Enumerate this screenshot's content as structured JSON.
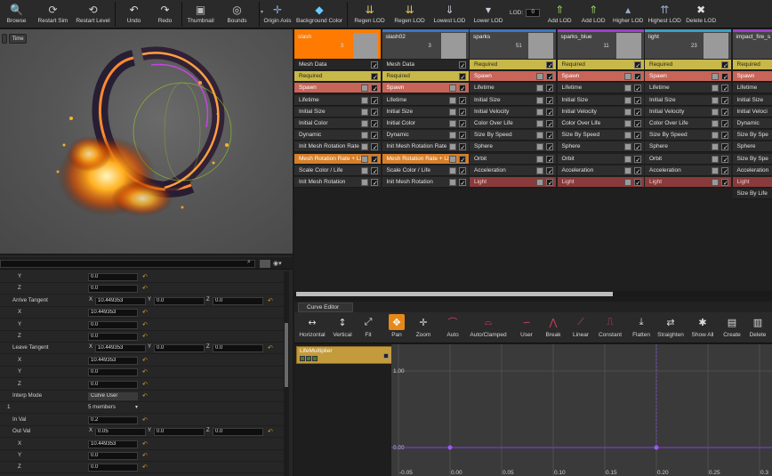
{
  "toolbar": {
    "buttons": [
      {
        "label": "Browse",
        "icon": "browse-icon"
      },
      {
        "label": "Restart Sim",
        "icon": "restart-sim-icon"
      },
      {
        "label": "Restart Level",
        "icon": "restart-level-icon"
      },
      {
        "label": "Undo",
        "icon": "undo-icon"
      },
      {
        "label": "Redo",
        "icon": "redo-icon"
      },
      {
        "label": "Thumbnail",
        "icon": "thumbnail-icon"
      },
      {
        "label": "Bounds",
        "icon": "bounds-icon"
      },
      {
        "label": "Origin Axis",
        "icon": "origin-axis-icon"
      },
      {
        "label": "Background Color",
        "icon": "background-color-icon"
      },
      {
        "label": "Regen LOD",
        "icon": "regen-lod-icon"
      },
      {
        "label": "Regen LOD",
        "icon": "regen-lod-icon"
      },
      {
        "label": "Lowest LOD",
        "icon": "lowest-lod-icon"
      },
      {
        "label": "Lower LOD",
        "icon": "lower-lod-icon"
      },
      {
        "label": "Add LOD",
        "icon": "add-lod-icon"
      },
      {
        "label": "Add LOD",
        "icon": "add-lod-icon"
      },
      {
        "label": "Higher LOD",
        "icon": "higher-lod-icon"
      },
      {
        "label": "Highest LOD",
        "icon": "highest-lod-icon"
      },
      {
        "label": "Delete LOD",
        "icon": "delete-lod-icon"
      }
    ],
    "lod_label": "LOD:",
    "lod_value": "0"
  },
  "viewport": {
    "time_button": "Time"
  },
  "details": {
    "rows": [
      {
        "label": "Y",
        "indent": 20,
        "fields": [
          "0.0"
        ]
      },
      {
        "label": "Z",
        "indent": 20,
        "fields": [
          "0.0"
        ]
      },
      {
        "label": "Arrive Tangent",
        "indent": 14,
        "xyz": [
          "10.449353",
          "0.0",
          "0.0"
        ]
      },
      {
        "label": "X",
        "indent": 20,
        "fields": [
          "10.449353"
        ]
      },
      {
        "label": "Y",
        "indent": 20,
        "fields": [
          "0.0"
        ]
      },
      {
        "label": "Z",
        "indent": 20,
        "fields": [
          "0.0"
        ]
      },
      {
        "label": "Leave Tangent",
        "indent": 14,
        "xyz": [
          "10.449353",
          "0.0",
          "0.0"
        ]
      },
      {
        "label": "X",
        "indent": 20,
        "fields": [
          "10.449353"
        ]
      },
      {
        "label": "Y",
        "indent": 20,
        "fields": [
          "0.0"
        ]
      },
      {
        "label": "Z",
        "indent": 20,
        "fields": [
          "0.0"
        ]
      },
      {
        "label": "Interp Mode",
        "indent": 14,
        "dropdown": "Curve User"
      },
      {
        "label": "1",
        "indent": 8,
        "members": "5 members"
      },
      {
        "label": "In Val",
        "indent": 14,
        "fields": [
          "0.2"
        ]
      },
      {
        "label": "Out Val",
        "indent": 14,
        "xyz": [
          "0.05",
          "0.0",
          "0.0"
        ]
      },
      {
        "label": "X",
        "indent": 20,
        "fields": [
          "10.449353"
        ]
      },
      {
        "label": "Y",
        "indent": 20,
        "fields": [
          "0.0"
        ]
      },
      {
        "label": "Z",
        "indent": 20,
        "fields": [
          "0.0"
        ]
      }
    ]
  },
  "emitters": [
    {
      "name": "slash",
      "count": "3",
      "color": "#ff7a00",
      "modules": [
        {
          "label": "Mesh Data",
          "style": "dark"
        },
        {
          "label": "Required",
          "style": "required"
        },
        {
          "label": "Spawn",
          "style": "spawn"
        },
        {
          "label": "Lifetime",
          "style": "normal"
        },
        {
          "label": "Initial Size",
          "style": "normal"
        },
        {
          "label": "Initial Color",
          "style": "normal"
        },
        {
          "label": "Dynamic",
          "style": "normal"
        },
        {
          "label": "Init Mesh Rotation Rate",
          "style": "normal"
        },
        {
          "label": "Mesh Rotation Rate + Lif",
          "style": "selected"
        },
        {
          "label": "Scale Color / Life",
          "style": "normal"
        },
        {
          "label": "Init Mesh Rotation",
          "style": "normal"
        }
      ]
    },
    {
      "name": "slash02",
      "count": "3",
      "color": "#3a76c4",
      "modules": [
        {
          "label": "Mesh Data",
          "style": "dark"
        },
        {
          "label": "Required",
          "style": "required"
        },
        {
          "label": "Spawn",
          "style": "spawn"
        },
        {
          "label": "Lifetime",
          "style": "normal"
        },
        {
          "label": "Initial Size",
          "style": "normal"
        },
        {
          "label": "Initial Color",
          "style": "normal"
        },
        {
          "label": "Dynamic",
          "style": "normal"
        },
        {
          "label": "Init Mesh Rotation Rate",
          "style": "normal"
        },
        {
          "label": "Mesh Rotation Rate + Lif",
          "style": "selected"
        },
        {
          "label": "Scale Color / Life",
          "style": "normal"
        },
        {
          "label": "Init Mesh Rotation",
          "style": "normal"
        }
      ]
    },
    {
      "name": "sparks",
      "count": "51",
      "color": "#3a76c4",
      "modules": [
        {
          "label": "Required",
          "style": "required"
        },
        {
          "label": "Spawn",
          "style": "spawn"
        },
        {
          "label": "Lifetime",
          "style": "normal"
        },
        {
          "label": "Initial Size",
          "style": "normal"
        },
        {
          "label": "Initial Velocity",
          "style": "normal"
        },
        {
          "label": "Color Over Life",
          "style": "normal"
        },
        {
          "label": "Size By Speed",
          "style": "normal"
        },
        {
          "label": "Sphere",
          "style": "normal"
        },
        {
          "label": "Orbit",
          "style": "normal"
        },
        {
          "label": "Acceleration",
          "style": "normal"
        },
        {
          "label": "Light",
          "style": "light"
        }
      ]
    },
    {
      "name": "sparks_blue",
      "count": "11",
      "color": "#9b3fd0",
      "modules": [
        {
          "label": "Required",
          "style": "required"
        },
        {
          "label": "Spawn",
          "style": "spawn"
        },
        {
          "label": "Lifetime",
          "style": "normal"
        },
        {
          "label": "Initial Size",
          "style": "normal"
        },
        {
          "label": "Initial Velocity",
          "style": "normal"
        },
        {
          "label": "Color Over Life",
          "style": "normal"
        },
        {
          "label": "Size By Speed",
          "style": "normal"
        },
        {
          "label": "Sphere",
          "style": "normal"
        },
        {
          "label": "Orbit",
          "style": "normal"
        },
        {
          "label": "Acceleration",
          "style": "normal"
        },
        {
          "label": "Light",
          "style": "light"
        }
      ]
    },
    {
      "name": "light",
      "count": "23",
      "color": "#3aa0c4",
      "modules": [
        {
          "label": "Required",
          "style": "required"
        },
        {
          "label": "Spawn",
          "style": "spawn"
        },
        {
          "label": "Lifetime",
          "style": "normal"
        },
        {
          "label": "Initial Size",
          "style": "normal"
        },
        {
          "label": "Initial Velocity",
          "style": "normal"
        },
        {
          "label": "Color Over Life",
          "style": "normal"
        },
        {
          "label": "Size By Speed",
          "style": "normal"
        },
        {
          "label": "Sphere",
          "style": "normal"
        },
        {
          "label": "Orbit",
          "style": "normal"
        },
        {
          "label": "Acceleration",
          "style": "normal"
        },
        {
          "label": "Light",
          "style": "light"
        }
      ]
    },
    {
      "name": "impact_fire_s",
      "count": "",
      "color": "#9b3fd0",
      "modules": [
        {
          "label": "Required",
          "style": "required"
        },
        {
          "label": "Spawn",
          "style": "spawn"
        },
        {
          "label": "Lifetime",
          "style": "normal"
        },
        {
          "label": "Initial Size",
          "style": "normal"
        },
        {
          "label": "Initial Veloci",
          "style": "normal"
        },
        {
          "label": "Dynamic",
          "style": "normal"
        },
        {
          "label": "Size By Spe",
          "style": "normal"
        },
        {
          "label": "Sphere",
          "style": "normal"
        },
        {
          "label": "Size By Spe",
          "style": "normal"
        },
        {
          "label": "Acceleration",
          "style": "normal"
        },
        {
          "label": "Light",
          "style": "light"
        },
        {
          "label": "Size By Life",
          "style": "dark"
        }
      ]
    }
  ],
  "curve_editor": {
    "tab_label": "Curve Editor",
    "tools": [
      {
        "label": "Horizontal",
        "icon": "horizontal-fit-icon"
      },
      {
        "label": "Vertical",
        "icon": "vertical-fit-icon"
      },
      {
        "label": "Fit",
        "icon": "fit-icon"
      },
      {
        "label": "Pan",
        "icon": "pan-icon"
      },
      {
        "label": "Zoom",
        "icon": "zoom-icon"
      },
      {
        "label": "Auto",
        "icon": "auto-tangent-icon"
      },
      {
        "label": "Auto/Clamped",
        "icon": "auto-clamped-icon"
      },
      {
        "label": "User",
        "icon": "user-tangent-icon"
      },
      {
        "label": "Break",
        "icon": "break-tangent-icon"
      },
      {
        "label": "Linear",
        "icon": "linear-icon"
      },
      {
        "label": "Constant",
        "icon": "constant-icon"
      },
      {
        "label": "Flatten",
        "icon": "flatten-icon"
      },
      {
        "label": "Straighten",
        "icon": "straighten-icon"
      },
      {
        "label": "Show All",
        "icon": "show-all-icon"
      },
      {
        "label": "Create",
        "icon": "create-icon"
      },
      {
        "label": "Delete",
        "icon": "delete-icon"
      }
    ],
    "curve_name": "LifeMultiplier",
    "y_labels": [
      "1.00",
      "0.00"
    ],
    "x_labels": [
      "-0.05",
      "0.00",
      "0.05",
      "0.10",
      "0.15",
      "0.20",
      "0.25",
      "0.3"
    ]
  }
}
